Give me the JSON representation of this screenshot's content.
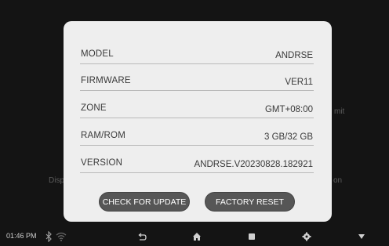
{
  "background": {
    "left_text": "Disp",
    "right_text_mid": "mit",
    "right_text_low": "on"
  },
  "dialog": {
    "rows": [
      {
        "label": "MODEL",
        "value": "ANDRSE"
      },
      {
        "label": "FIRMWARE",
        "value": "VER11"
      },
      {
        "label": "ZONE",
        "value": "GMT+08:00"
      },
      {
        "label": "RAM/ROM",
        "value": "3 GB/32 GB"
      },
      {
        "label": "VERSION",
        "value": "ANDRSE.V20230828.182921"
      }
    ],
    "check_update_label": "CHECK FOR UPDATE",
    "factory_reset_label": "FACTORY RESET"
  },
  "statusbar": {
    "time": "01:46 PM",
    "icons": [
      "bluetooth-icon",
      "wifi-icon"
    ]
  },
  "navbar": {
    "icons": [
      "back-icon",
      "home-icon",
      "recents-icon",
      "settings-icon",
      "hide-icon"
    ]
  }
}
